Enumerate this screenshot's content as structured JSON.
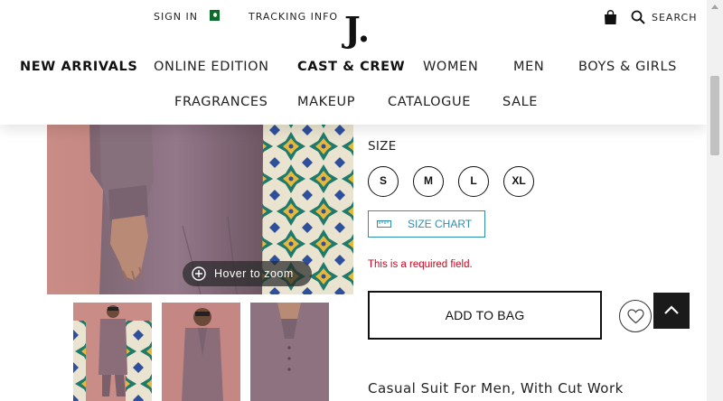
{
  "header": {
    "sign_in": "SIGN IN",
    "tracking": "TRACKING INFO",
    "logo": "J.",
    "search": "SEARCH",
    "country_flag": "pakistan-flag"
  },
  "nav": {
    "row1": [
      "NEW ARRIVALS",
      "ONLINE EDITION",
      "CAST & CREW",
      "WOMEN",
      "MEN",
      "BOYS & GIRLS"
    ],
    "row2": [
      "FRAGRANCES",
      "MAKEUP",
      "CATALOGUE",
      "SALE"
    ]
  },
  "gallery": {
    "zoom_hint": "Hover to zoom"
  },
  "product": {
    "size_label": "SIZE",
    "sizes": [
      "S",
      "M",
      "L",
      "XL"
    ],
    "size_chart": "SIZE CHART",
    "required_msg": "This is a required field.",
    "add_to_bag": "ADD TO BAG",
    "name": "Casual Suit For Men, With Cut Work"
  },
  "colors": {
    "accent_link": "#2c8fb0",
    "error": "#d0021b",
    "suit": "#8a6d78",
    "wall": "#c48783"
  }
}
